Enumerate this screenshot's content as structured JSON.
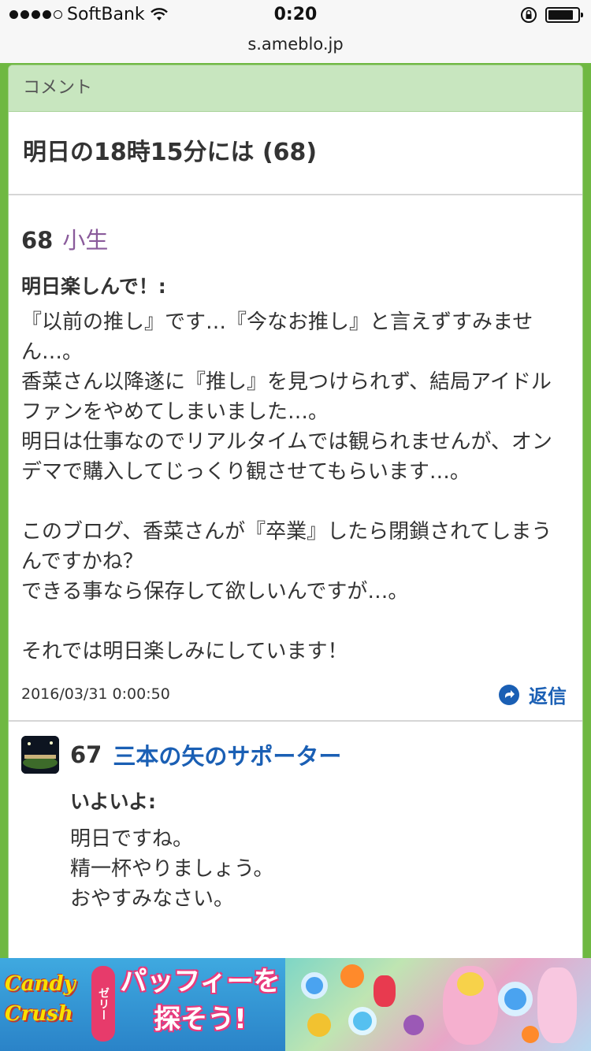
{
  "status_bar": {
    "carrier": "SoftBank",
    "time": "0:20",
    "battery_level": 0.85
  },
  "browser": {
    "url": "s.ameblo.jp"
  },
  "panel": {
    "header": "コメント",
    "entry_title": "明日の18時15分には (68)"
  },
  "comments": [
    {
      "number": "68",
      "author": "小生",
      "subject": "明日楽しんで！:",
      "body": "『以前の推し』です…『今なお推し』と言えずすみません…。\n香菜さん以降遂に『推し』を見つけられず、結局アイドルファンをやめてしまいました…。\n明日は仕事なのでリアルタイムでは観られませんが、オンデマで購入してじっくり観させてもらいます…。\n\nこのブログ、香菜さんが『卒業』したら閉鎖されてしまうんですかね？\nできる事なら保存して欲しいんですが…。\n\nそれでは明日楽しみにしています！",
      "date": "2016/03/31 0:00:50",
      "reply_label": "返信"
    },
    {
      "number": "67",
      "author": "三本の矢のサポーター",
      "subject": "いよいよ:",
      "body": "明日ですね。\n精一杯やりましょう。\nおやすみなさい。"
    }
  ],
  "ad": {
    "logo": "Candy Crush",
    "sub_logo": "ゼリー",
    "headline": "パッフィーを探そう!"
  },
  "colors": {
    "page_bg": "#6fb842",
    "header_bg": "#c8e6bf",
    "link": "#1a5fb4",
    "author_purple": "#8a5b9b"
  }
}
